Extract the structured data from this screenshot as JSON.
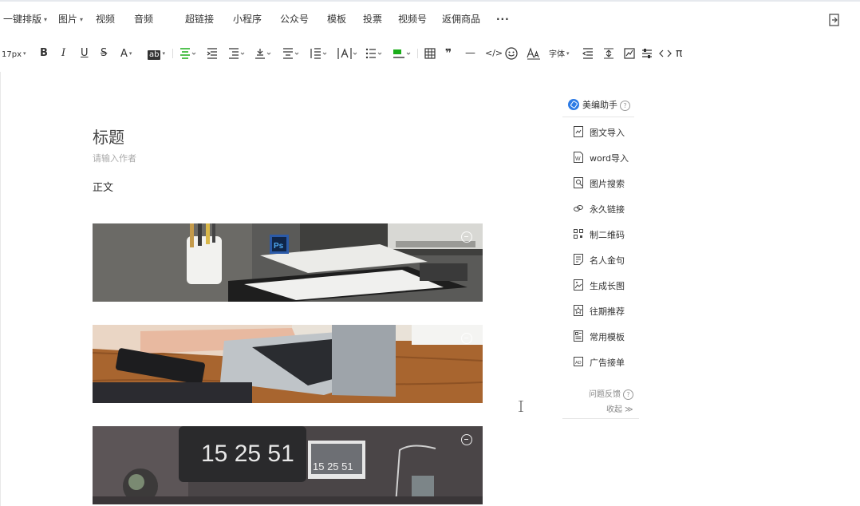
{
  "menu": {
    "items": [
      {
        "label": "一键排版",
        "dropdown": true
      },
      {
        "label": "图片",
        "dropdown": true
      },
      {
        "label": "视频",
        "dropdown": false
      },
      {
        "label": "音频",
        "dropdown": false
      },
      {
        "label": "超链接",
        "dropdown": false
      },
      {
        "label": "小程序",
        "dropdown": false
      },
      {
        "label": "公众号",
        "dropdown": false
      },
      {
        "label": "模板",
        "dropdown": false
      },
      {
        "label": "投票",
        "dropdown": false
      },
      {
        "label": "视频号",
        "dropdown": false
      },
      {
        "label": "返佣商品",
        "dropdown": false
      }
    ],
    "more": "···"
  },
  "toolbar": {
    "font_size": "17px",
    "bold": "B",
    "italic": "I",
    "underline": "U",
    "strike": "S",
    "font_color": "A",
    "highlight": "ab",
    "quote": "❞",
    "hr": "—",
    "code": "</>",
    "font_family": "字体",
    "pi": "π",
    "colors": {
      "active": "#1aad19",
      "text": "#333333"
    }
  },
  "editor": {
    "title": "标题",
    "author_placeholder": "请输入作者",
    "body": "正文"
  },
  "panel": {
    "title": "美编助手",
    "help": "?",
    "items": [
      "图文导入",
      "word导入",
      "图片搜索",
      "永久链接",
      "制二维码",
      "名人金句",
      "生成长图",
      "往期推荐",
      "常用模板",
      "广告接单"
    ],
    "feedback": "问题反馈",
    "collapse": "收起 ≫"
  },
  "images": [
    {
      "alt_icon": "photoshop-badge",
      "overlay_text": "Ps"
    },
    {
      "alt_icon": "laptop-desk"
    },
    {
      "alt_icon": "clock-desk",
      "overlay_text": "15 25 51",
      "overlay_text_small": "15 25 51"
    }
  ]
}
